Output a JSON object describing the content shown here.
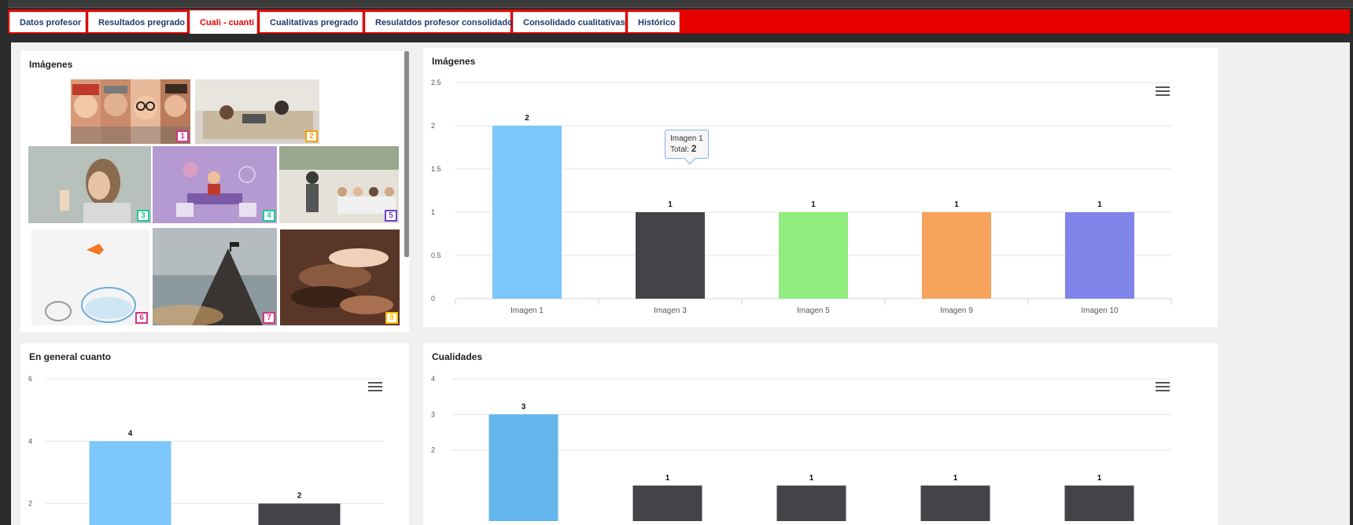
{
  "tabs": [
    {
      "label": "Datos profesor",
      "active": false
    },
    {
      "label": "Resultados pregrado",
      "active": false
    },
    {
      "label": "Cuali - cuanti",
      "active": true
    },
    {
      "label": "Cualitativas pregrado",
      "active": false
    },
    {
      "label": "Resulatdos profesor consolidado",
      "active": false
    },
    {
      "label": "Consolidado cualitativas",
      "active": false
    },
    {
      "label": "Histórico",
      "active": false
    }
  ],
  "panels": {
    "images_gallery": {
      "title": "Imágenes",
      "badges": [
        "1",
        "2",
        "3",
        "4",
        "5",
        "6",
        "7",
        "8"
      ]
    },
    "images_chart": {
      "title": "Imágenes"
    },
    "general_chart": {
      "title": "En general cuanto"
    },
    "qualities_chart": {
      "title": "Cualidades"
    }
  },
  "tooltip": {
    "label": "Imagen 1",
    "total_label": "Total:",
    "total_value": "2"
  },
  "chart_data": [
    {
      "type": "bar",
      "title": "Imágenes",
      "categories": [
        "Imagen 1",
        "Imagen 3",
        "Imagen 5",
        "Imagen 9",
        "Imagen 10"
      ],
      "values": [
        2,
        1,
        1,
        1,
        1
      ],
      "colors": [
        "#7cc7fb",
        "#434348",
        "#90ed7d",
        "#f7a35c",
        "#8085e9"
      ],
      "yticks": [
        "0",
        "0.5",
        "1",
        "1.5",
        "2",
        "2.5"
      ],
      "ylim": [
        0,
        2.5
      ],
      "grid": true
    },
    {
      "type": "bar",
      "title": "En general cuanto",
      "values": [
        4,
        2
      ],
      "colors": [
        "#7cc7fb",
        "#434348"
      ],
      "yticks": [
        "2",
        "4",
        "6"
      ],
      "ylim": [
        0,
        6
      ],
      "grid": true
    },
    {
      "type": "bar",
      "title": "Cualidades",
      "values": [
        3,
        1,
        1,
        1,
        1
      ],
      "colors": [
        "#64b5ec",
        "#434348",
        "#434348",
        "#434348",
        "#434348"
      ],
      "yticks": [
        "2",
        "3",
        "4"
      ],
      "ylim": [
        0,
        4
      ],
      "grid": true
    }
  ],
  "colors": {
    "accent": "#e60000",
    "tab_text": "#1f3a6e"
  }
}
